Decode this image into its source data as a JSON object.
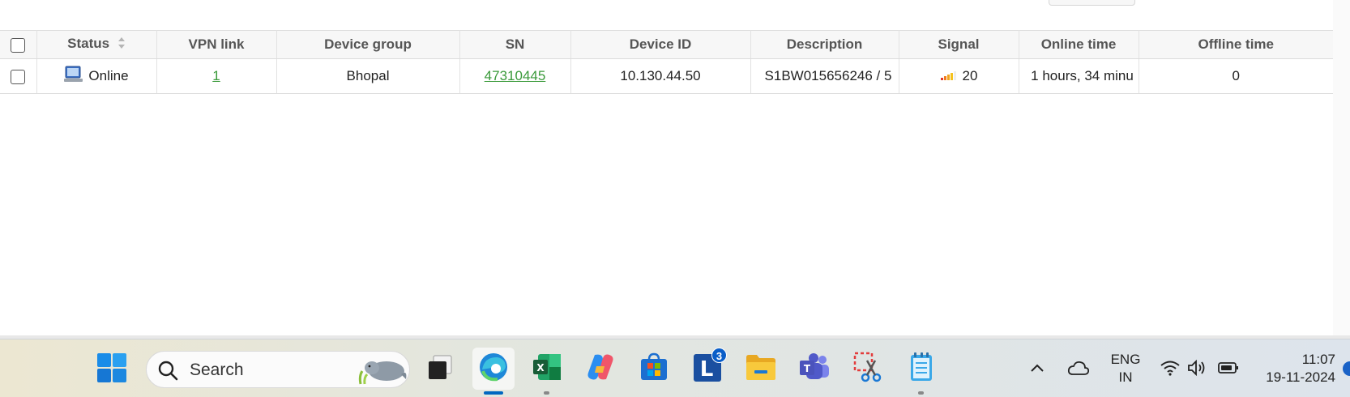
{
  "table": {
    "columns": [
      "Status",
      "VPN link",
      "Device group",
      "SN",
      "Device ID",
      "Description",
      "Signal",
      "Online time",
      "Offline time"
    ],
    "rows": [
      {
        "status": "Online",
        "vpn_link": "1",
        "device_group": "Bhopal",
        "sn": "47310445",
        "device_id": "10.130.44.50",
        "description": "S1BW015656246 / 5",
        "signal": "20",
        "online_time": "1 hours, 34 minu",
        "offline_time": "0"
      }
    ]
  },
  "taskbar": {
    "search_placeholder": "Search",
    "apps": [
      "file-explorer-window",
      "edge",
      "excel",
      "copilot",
      "microsoft-store",
      "l-app",
      "file-explorer",
      "teams",
      "snipping-tool",
      "notepad"
    ],
    "l_app_badge": "3",
    "language_line1": "ENG",
    "language_line2": "IN",
    "time": "11:07",
    "date": "19-11-2024"
  },
  "colors": {
    "status_online": "#2e8b1e",
    "link": "#3a9a3a",
    "header_bg": "#f7f7f7",
    "accent": "#0067c0"
  }
}
